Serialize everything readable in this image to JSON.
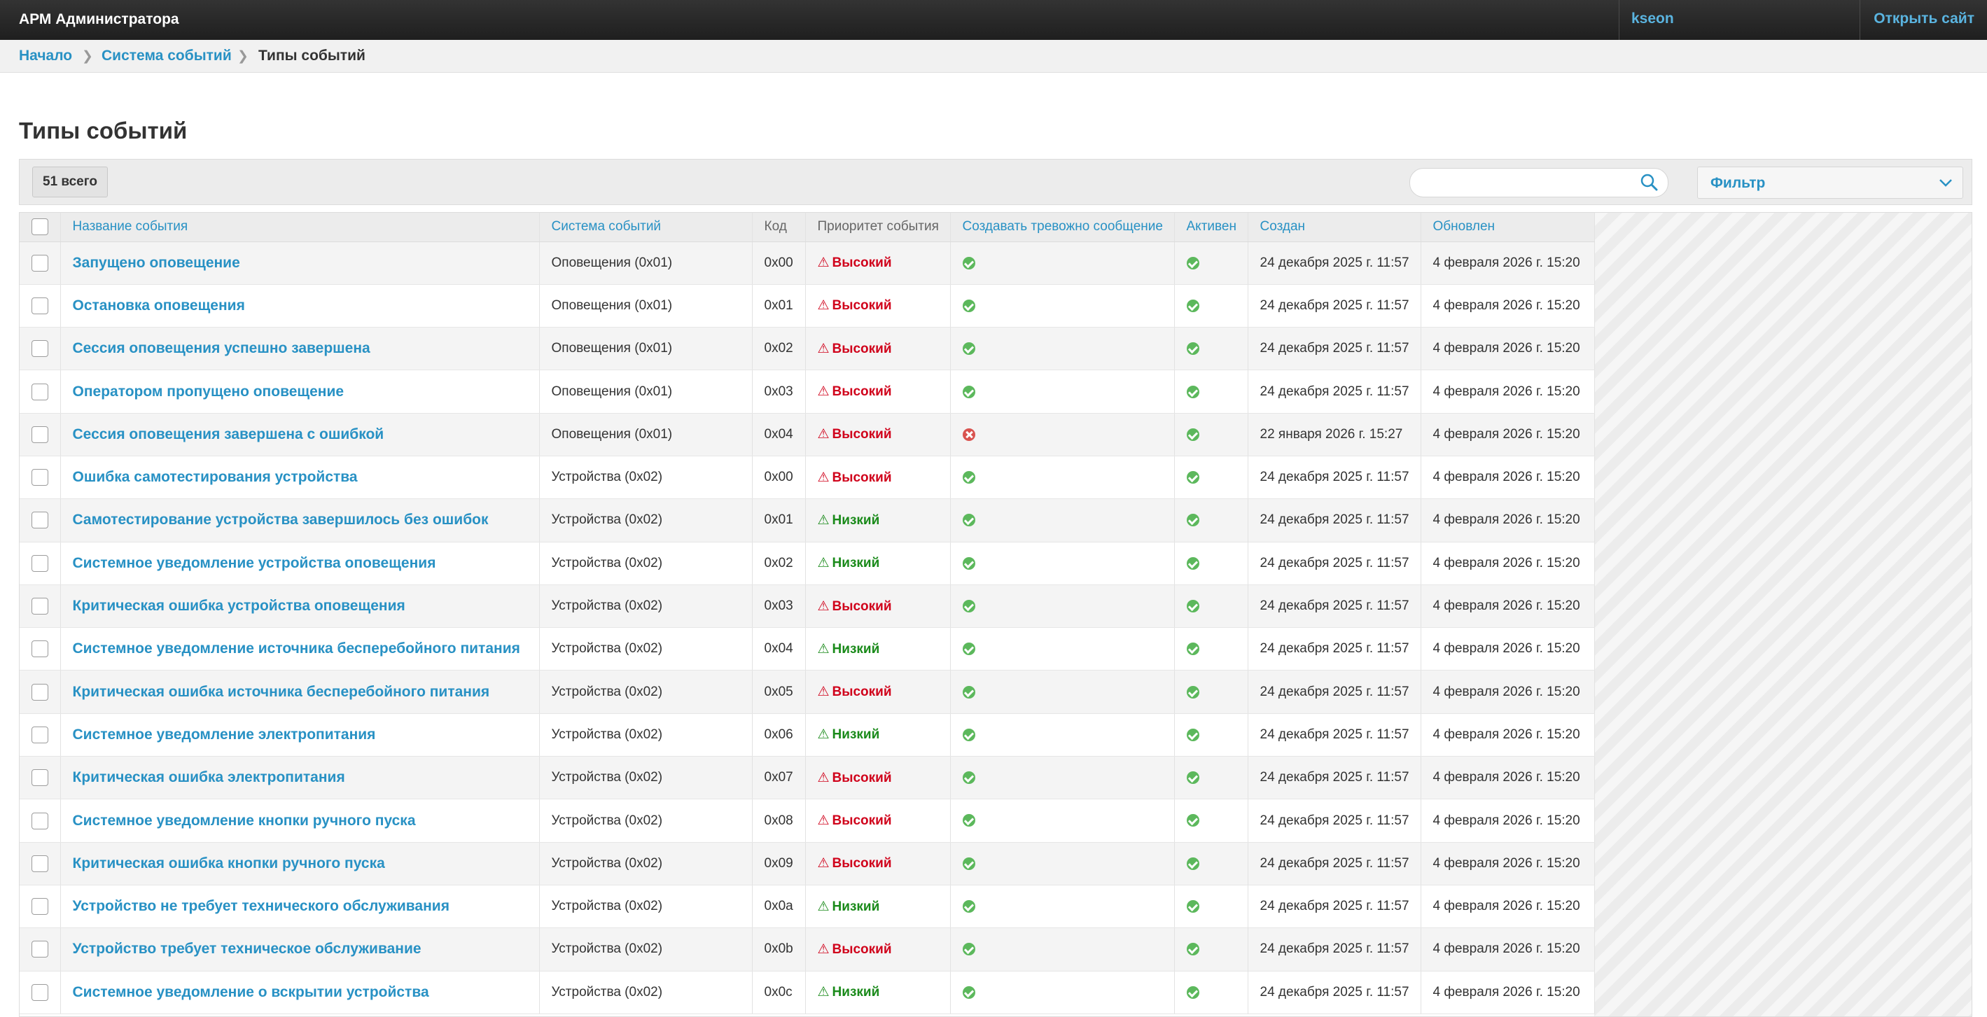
{
  "header": {
    "app_title": "АРМ Администратора",
    "username": "kseon",
    "open_site": "Открыть сайт"
  },
  "breadcrumb": {
    "home": "Начало",
    "section": "Система событий",
    "current": "Типы событий"
  },
  "page_title": "Типы событий",
  "toolbar": {
    "total_count": "51 всего",
    "search_value": "",
    "filter_label": "Фильтр"
  },
  "columns": {
    "name": "Название события",
    "system": "Система событий",
    "code": "Код",
    "priority": "Приоритет события",
    "create_alarm": "Создавать тревожно сообщение",
    "active": "Активен",
    "created": "Создан",
    "updated": "Обновлен"
  },
  "colors": {
    "link": "#2891c4",
    "high": "#d0021b",
    "low": "#1a8a1a",
    "ok": "#5cb85c",
    "no": "#d9534f"
  },
  "rows": [
    {
      "name": "Запущено оповещение",
      "system": "Оповещения (0x01)",
      "code": "0x00",
      "priority": "Высокий",
      "level": "high",
      "alarm": true,
      "active": true,
      "created": "24 декабря 2025 г. 11:57",
      "updated": "4 февраля 2026 г. 15:20"
    },
    {
      "name": "Остановка оповещения",
      "system": "Оповещения (0x01)",
      "code": "0x01",
      "priority": "Высокий",
      "level": "high",
      "alarm": true,
      "active": true,
      "created": "24 декабря 2025 г. 11:57",
      "updated": "4 февраля 2026 г. 15:20"
    },
    {
      "name": "Сессия оповещения успешно завершена",
      "system": "Оповещения (0x01)",
      "code": "0x02",
      "priority": "Высокий",
      "level": "high",
      "alarm": true,
      "active": true,
      "created": "24 декабря 2025 г. 11:57",
      "updated": "4 февраля 2026 г. 15:20"
    },
    {
      "name": "Оператором пропущено оповещение",
      "system": "Оповещения (0x01)",
      "code": "0x03",
      "priority": "Высокий",
      "level": "high",
      "alarm": true,
      "active": true,
      "created": "24 декабря 2025 г. 11:57",
      "updated": "4 февраля 2026 г. 15:20"
    },
    {
      "name": "Сессия оповещения завершена с ошибкой",
      "system": "Оповещения (0x01)",
      "code": "0x04",
      "priority": "Высокий",
      "level": "high",
      "alarm": false,
      "active": true,
      "created": "22 января 2026 г. 15:27",
      "updated": "4 февраля 2026 г. 15:20"
    },
    {
      "name": "Ошибка самотестирования устройства",
      "system": "Устройства (0x02)",
      "code": "0x00",
      "priority": "Высокий",
      "level": "high",
      "alarm": true,
      "active": true,
      "created": "24 декабря 2025 г. 11:57",
      "updated": "4 февраля 2026 г. 15:20"
    },
    {
      "name": "Самотестирование устройства завершилось без ошибок",
      "system": "Устройства (0x02)",
      "code": "0x01",
      "priority": "Низкий",
      "level": "low",
      "alarm": true,
      "active": true,
      "created": "24 декабря 2025 г. 11:57",
      "updated": "4 февраля 2026 г. 15:20"
    },
    {
      "name": "Системное уведомление устройства оповещения",
      "system": "Устройства (0x02)",
      "code": "0x02",
      "priority": "Низкий",
      "level": "low",
      "alarm": true,
      "active": true,
      "created": "24 декабря 2025 г. 11:57",
      "updated": "4 февраля 2026 г. 15:20"
    },
    {
      "name": "Критическая ошибка устройства оповещения",
      "system": "Устройства (0x02)",
      "code": "0x03",
      "priority": "Высокий",
      "level": "high",
      "alarm": true,
      "active": true,
      "created": "24 декабря 2025 г. 11:57",
      "updated": "4 февраля 2026 г. 15:20"
    },
    {
      "name": "Системное уведомление источника бесперебойного питания",
      "system": "Устройства (0x02)",
      "code": "0x04",
      "priority": "Низкий",
      "level": "low",
      "alarm": true,
      "active": true,
      "created": "24 декабря 2025 г. 11:57",
      "updated": "4 февраля 2026 г. 15:20"
    },
    {
      "name": "Критическая ошибка источника бесперебойного питания",
      "system": "Устройства (0x02)",
      "code": "0x05",
      "priority": "Высокий",
      "level": "high",
      "alarm": true,
      "active": true,
      "created": "24 декабря 2025 г. 11:57",
      "updated": "4 февраля 2026 г. 15:20"
    },
    {
      "name": "Системное уведомление электропитания",
      "system": "Устройства (0x02)",
      "code": "0x06",
      "priority": "Низкий",
      "level": "low",
      "alarm": true,
      "active": true,
      "created": "24 декабря 2025 г. 11:57",
      "updated": "4 февраля 2026 г. 15:20"
    },
    {
      "name": "Критическая ошибка электропитания",
      "system": "Устройства (0x02)",
      "code": "0x07",
      "priority": "Высокий",
      "level": "high",
      "alarm": true,
      "active": true,
      "created": "24 декабря 2025 г. 11:57",
      "updated": "4 февраля 2026 г. 15:20"
    },
    {
      "name": "Системное уведомление кнопки ручного пуска",
      "system": "Устройства (0x02)",
      "code": "0x08",
      "priority": "Высокий",
      "level": "high",
      "alarm": true,
      "active": true,
      "created": "24 декабря 2025 г. 11:57",
      "updated": "4 февраля 2026 г. 15:20"
    },
    {
      "name": "Критическая ошибка кнопки ручного пуска",
      "system": "Устройства (0x02)",
      "code": "0x09",
      "priority": "Высокий",
      "level": "high",
      "alarm": true,
      "active": true,
      "created": "24 декабря 2025 г. 11:57",
      "updated": "4 февраля 2026 г. 15:20"
    },
    {
      "name": "Устройство не требует технического обслуживания",
      "system": "Устройства (0x02)",
      "code": "0x0a",
      "priority": "Низкий",
      "level": "low",
      "alarm": true,
      "active": true,
      "created": "24 декабря 2025 г. 11:57",
      "updated": "4 февраля 2026 г. 15:20"
    },
    {
      "name": "Устройство требует техническое обслуживание",
      "system": "Устройства (0x02)",
      "code": "0x0b",
      "priority": "Высокий",
      "level": "high",
      "alarm": true,
      "active": true,
      "created": "24 декабря 2025 г. 11:57",
      "updated": "4 февраля 2026 г. 15:20"
    },
    {
      "name": "Системное уведомление о вскрытии устройства",
      "system": "Устройства (0x02)",
      "code": "0x0c",
      "priority": "Низкий",
      "level": "low",
      "alarm": true,
      "active": true,
      "created": "24 декабря 2025 г. 11:57",
      "updated": "4 февраля 2026 г. 15:20"
    }
  ]
}
